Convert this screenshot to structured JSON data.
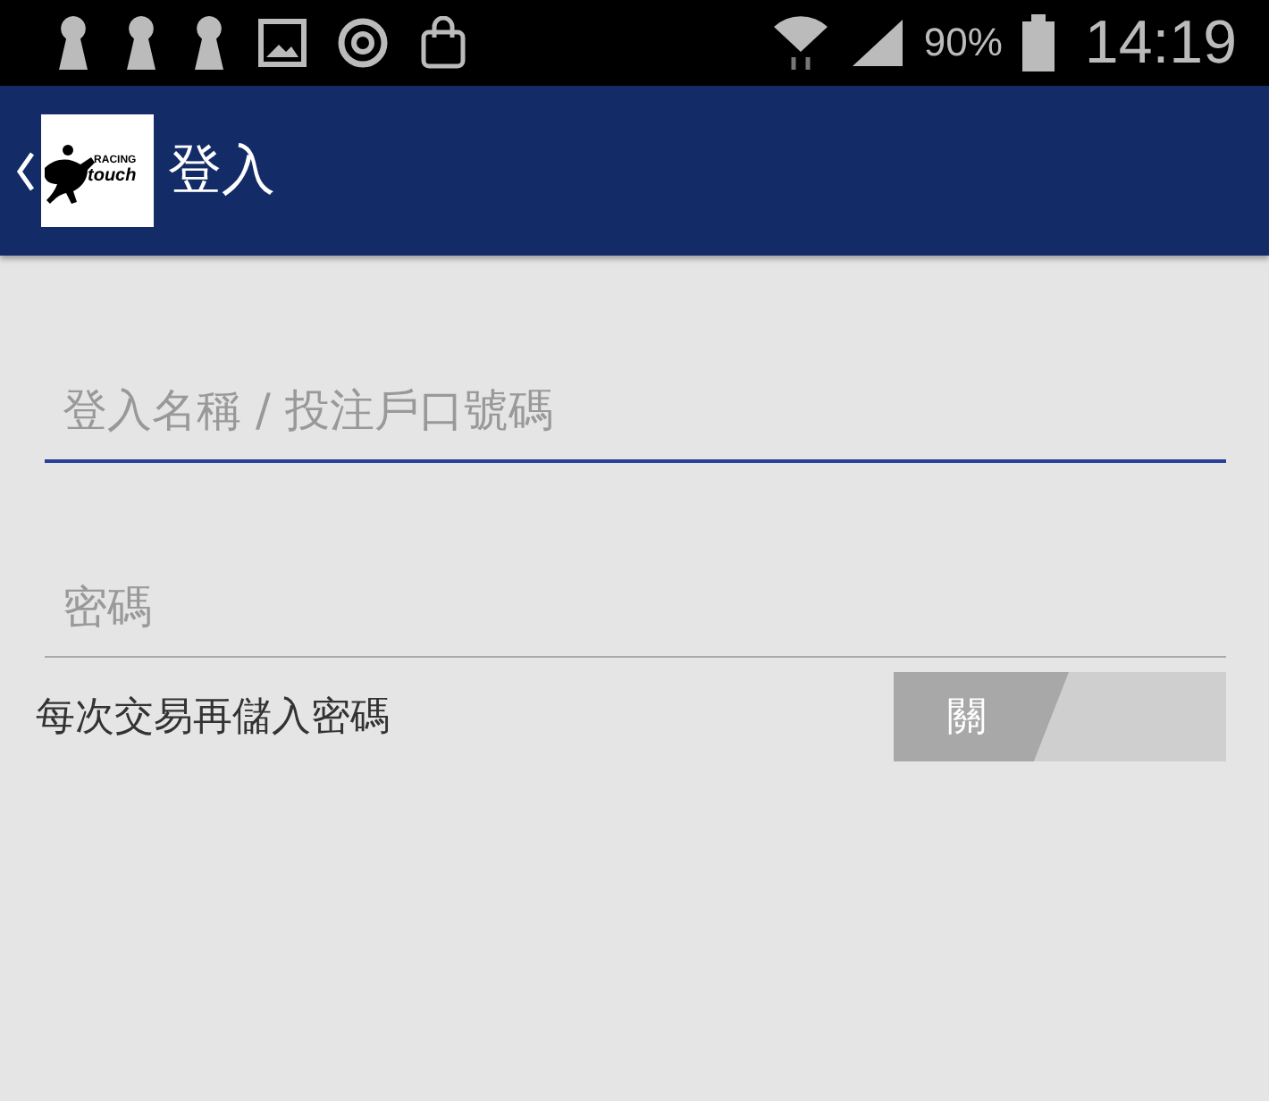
{
  "status_bar": {
    "battery": "90%",
    "time": "14:19"
  },
  "app_bar": {
    "logo": {
      "line_1": "RACING",
      "line_2": "touch"
    },
    "title": "登入"
  },
  "fields": [
    {
      "placeholder": "登入名稱 / 投注戶口號碼",
      "focused": true
    },
    {
      "placeholder": "密碼",
      "focused": false
    }
  ],
  "setting": {
    "label": "每次交易再儲入密碼",
    "switch_text": "關",
    "on": false
  }
}
